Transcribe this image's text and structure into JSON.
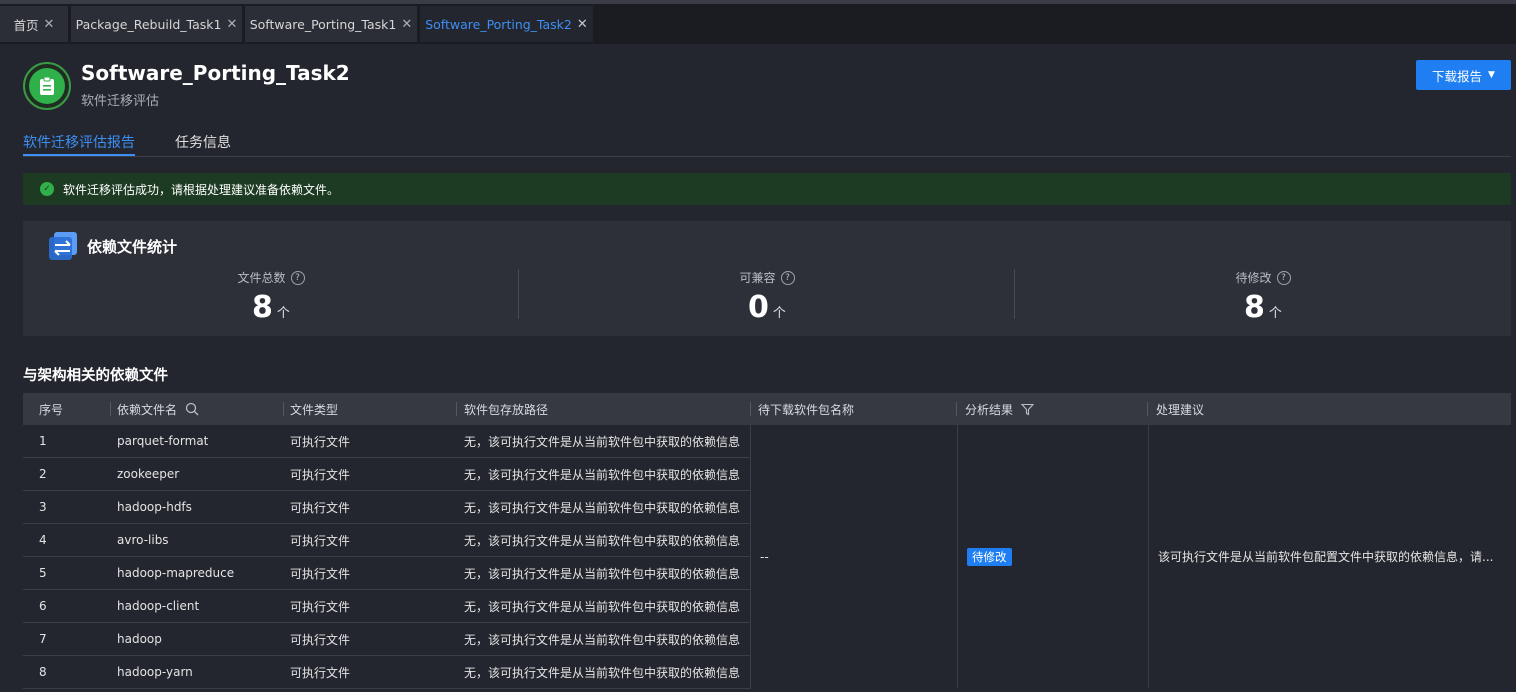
{
  "tabs": [
    {
      "label": "首页",
      "active": false
    },
    {
      "label": "Package_Rebuild_Task1",
      "active": false
    },
    {
      "label": "Software_Porting_Task1",
      "active": false
    },
    {
      "label": "Software_Porting_Task2",
      "active": true
    }
  ],
  "header": {
    "title": "Software_Porting_Task2",
    "subtitle": "软件迁移评估",
    "download_label": "下载报告"
  },
  "page_tabs": [
    {
      "label": "软件迁移评估报告",
      "active": true
    },
    {
      "label": "任务信息",
      "active": false
    }
  ],
  "alert": {
    "text": "软件迁移评估成功，请根据处理建议准备依赖文件。"
  },
  "stats": {
    "title": "依赖文件统计",
    "items": [
      {
        "label": "文件总数",
        "value": "8",
        "unit": "个"
      },
      {
        "label": "可兼容",
        "value": "0",
        "unit": "个"
      },
      {
        "label": "待修改",
        "value": "8",
        "unit": "个"
      }
    ]
  },
  "section": {
    "title": "与架构相关的依赖文件"
  },
  "table": {
    "headers": [
      "序号",
      "依赖文件名",
      "文件类型",
      "软件包存放路径",
      "待下载软件包名称",
      "分析结果",
      "处理建议"
    ],
    "rows": [
      {
        "index": "1",
        "name": "parquet-format",
        "type": "可执行文件",
        "path": "无，该可执行文件是从当前软件包中获取的依赖信息"
      },
      {
        "index": "2",
        "name": "zookeeper",
        "type": "可执行文件",
        "path": "无，该可执行文件是从当前软件包中获取的依赖信息"
      },
      {
        "index": "3",
        "name": "hadoop-hdfs",
        "type": "可执行文件",
        "path": "无，该可执行文件是从当前软件包中获取的依赖信息"
      },
      {
        "index": "4",
        "name": "avro-libs",
        "type": "可执行文件",
        "path": "无，该可执行文件是从当前软件包中获取的依赖信息"
      },
      {
        "index": "5",
        "name": "hadoop-mapreduce",
        "type": "可执行文件",
        "path": "无，该可执行文件是从当前软件包中获取的依赖信息"
      },
      {
        "index": "6",
        "name": "hadoop-client",
        "type": "可执行文件",
        "path": "无，该可执行文件是从当前软件包中获取的依赖信息"
      },
      {
        "index": "7",
        "name": "hadoop",
        "type": "可执行文件",
        "path": "无，该可执行文件是从当前软件包中获取的依赖信息"
      },
      {
        "index": "8",
        "name": "hadoop-yarn",
        "type": "可执行文件",
        "path": "无，该可执行文件是从当前软件包中获取的依赖信息"
      }
    ],
    "merged": {
      "download_name": "--",
      "result": "待修改",
      "suggestion": "该可执行文件是从当前软件包配置文件中获取的依赖信息，请..."
    }
  },
  "colors": {
    "accent": "#1f7ff2",
    "success": "#2fb04a",
    "background": "#23262e"
  }
}
